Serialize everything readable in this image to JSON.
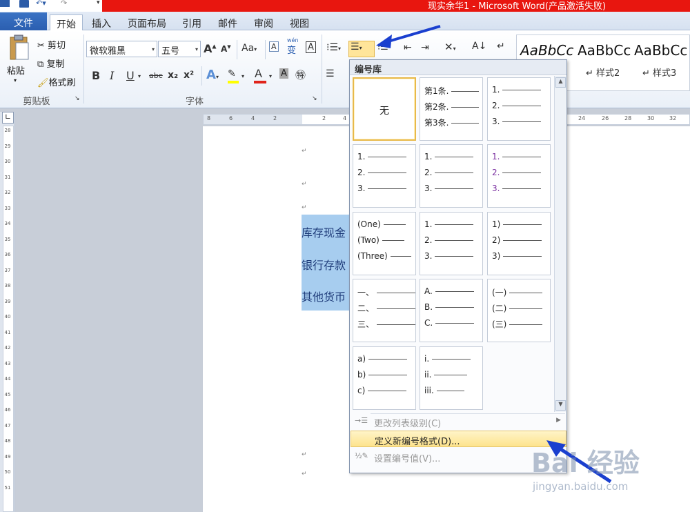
{
  "window": {
    "title": "现实余华1 - Microsoft Word(产品激活失败)"
  },
  "tabs": [
    {
      "label": "文件",
      "kind": "file"
    },
    {
      "label": "开始",
      "kind": "active"
    },
    {
      "label": "插入"
    },
    {
      "label": "页面布局"
    },
    {
      "label": "引用"
    },
    {
      "label": "邮件"
    },
    {
      "label": "审阅"
    },
    {
      "label": "视图"
    }
  ],
  "clipboard": {
    "paste_label": "粘贴",
    "cut_label": "剪切",
    "copy_label": "复制",
    "format_painter_label": "格式刷",
    "group_label": "剪贴板"
  },
  "font": {
    "font_name": "微软雅黑",
    "font_size": "五号",
    "group_label": "字体",
    "bold": "B",
    "italic": "I",
    "underline": "U",
    "strike": "abc",
    "subscript": "x₂",
    "superscript": "x²",
    "grow": "A",
    "shrink": "A",
    "change_case": "Aa",
    "wen": "wén",
    "pinyin": "变",
    "border": "A",
    "highlight_color": "#ffff00",
    "font_color": "#e0241b"
  },
  "styles": {
    "items": [
      {
        "preview": "AaBbCc",
        "label": ""
      },
      {
        "preview": "AaBbCc",
        "label": "↵ 样式2"
      },
      {
        "preview": "AaBbCc",
        "label": "↵ 样式3"
      }
    ]
  },
  "document": {
    "selected_lines": [
      "库存现金",
      "银行存款",
      "其他货币"
    ],
    "para_mark": "↵"
  },
  "ruler": {
    "left_numbers": [
      "28",
      "29",
      "30",
      "31",
      "32",
      "33",
      "34",
      "35",
      "36",
      "37",
      "38",
      "39",
      "40",
      "41",
      "42",
      "43",
      "44",
      "45",
      "46",
      "47",
      "48",
      "49",
      "50",
      "51"
    ],
    "top_numbers_left": [
      "8",
      "6",
      "4",
      "2"
    ],
    "top_numbers_right": [
      "2",
      "4",
      "24",
      "26",
      "28",
      "30",
      "32"
    ]
  },
  "numbering_library": {
    "header": "编号库",
    "cells": [
      {
        "type": "none",
        "text": "无",
        "selected": true
      },
      {
        "lines": [
          "第1条.",
          "第2条.",
          "第3条."
        ]
      },
      {
        "lines": [
          "1.",
          "2.",
          "3."
        ]
      },
      {
        "lines": [
          "1.",
          "2.",
          "3."
        ]
      },
      {
        "lines": [
          "1.",
          "2.",
          "3."
        ]
      },
      {
        "lines": [
          "1.",
          "2.",
          "3."
        ],
        "accent": true
      },
      {
        "lines": [
          "(One)",
          "(Two)",
          "(Three)"
        ]
      },
      {
        "lines": [
          "1.",
          "2.",
          "3."
        ]
      },
      {
        "lines": [
          "1)",
          "2)",
          "3)"
        ]
      },
      {
        "lines": [
          "一、",
          "二、",
          "三、"
        ]
      },
      {
        "lines": [
          "A.",
          "B.",
          "C."
        ]
      },
      {
        "lines": [
          "(一)",
          "(二)",
          "(三)"
        ]
      },
      {
        "lines": [
          "a)",
          "b)",
          "c)"
        ]
      },
      {
        "lines": [
          "i.",
          "ii.",
          "iii."
        ]
      }
    ],
    "menu": [
      {
        "label": "更改列表级别(C)",
        "disabled": true,
        "submenu": true
      },
      {
        "label": "定义新编号格式(D)...",
        "hover": true
      },
      {
        "label": "设置编号值(V)...",
        "disabled": true
      }
    ]
  },
  "watermark": {
    "brand": "Bai 经验",
    "url": "jingyan.baidu.com"
  },
  "colors": {
    "accent_blue": "#2a5eb0",
    "title_red": "#e8160f",
    "selection": "#a7cdef",
    "hover_item": "#fde38c",
    "annotation_arrow": "#1a3fcf"
  }
}
